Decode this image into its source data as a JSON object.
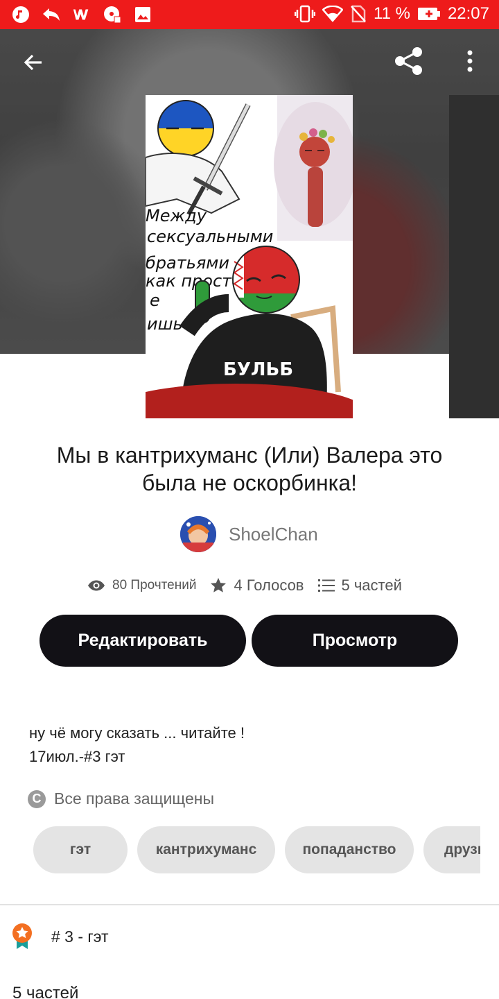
{
  "status_bar": {
    "battery": "11 %",
    "time": "22:07",
    "left_icons": [
      "music-icon",
      "reply-icon",
      "wattpad-icon",
      "cd-icon",
      "image-icon"
    ]
  },
  "header": {
    "back_icon": "arrow-left-icon",
    "share_icon": "share-icon",
    "more_icon": "more-vert-icon"
  },
  "cover": {
    "text_lines": [
      "Между",
      "сексуальными",
      "братьями",
      "как просто",
      "е",
      "ишь"
    ],
    "shirt_text": "БУЛЬБ"
  },
  "story": {
    "title": "Мы в кантрихуманс (Или) Валера это была не оскорбинка!",
    "author": "ShoelChan",
    "reads": "80 Прочтений",
    "votes": "4 Голосов",
    "parts": "5 частей"
  },
  "actions": {
    "edit_label": "Редактировать",
    "view_label": "Просмотр"
  },
  "description": {
    "line1": "ну чё могу сказать ... читайте !",
    "line2": "17июл.-#3 гэт"
  },
  "rights": {
    "icon_glyph": "C",
    "label": "Все права защищены"
  },
  "tags": [
    "гэт",
    "кантрихуманс",
    "попаданство",
    "друзья"
  ],
  "ranking": {
    "label": "# 3 - гэт"
  },
  "parts_section": {
    "heading": "5 частей"
  },
  "colors": {
    "status_bar": "#ee1b1b",
    "button": "#121116",
    "tag_bg": "#e4e4e4",
    "ranking_badge": "#f36f21"
  }
}
